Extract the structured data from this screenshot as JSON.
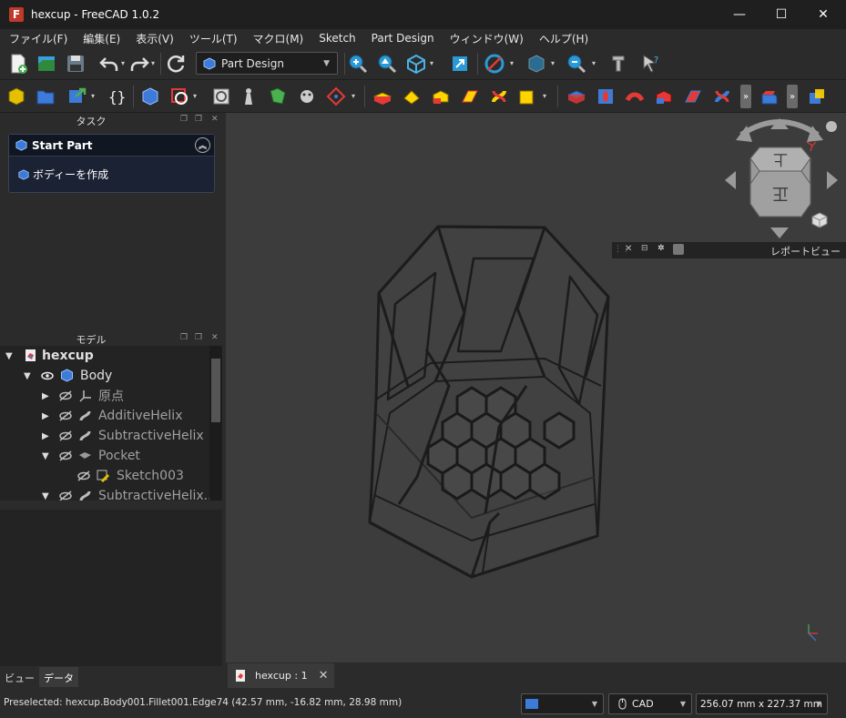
{
  "window": {
    "title": "hexcup - FreeCAD 1.0.2",
    "minimize": "—",
    "maximize": "☐",
    "close": "✕"
  },
  "menu": {
    "items": [
      "ファイル(F)",
      "編集(E)",
      "表示(V)",
      "ツール(T)",
      "マクロ(M)",
      "Sketch",
      "Part Design",
      "ウィンドウ(W)",
      "ヘルプ(H)"
    ]
  },
  "toolbar": {
    "workbench": "Part Design",
    "more": "»"
  },
  "task_panel": {
    "title": "タスク",
    "header": "Start Part",
    "action": "ボディーを作成"
  },
  "model_panel": {
    "title": "モデル",
    "tree": [
      {
        "label": "hexcup"
      },
      {
        "label": "Body"
      },
      {
        "label": "原点"
      },
      {
        "label": "AdditiveHelix"
      },
      {
        "label": "SubtractiveHelix"
      },
      {
        "label": "Pocket"
      },
      {
        "label": "Sketch003"
      },
      {
        "label": "SubtractiveHelix..."
      }
    ]
  },
  "left_tabs": [
    "ビュー",
    "データ"
  ],
  "report_view": {
    "title": "レポートビュー"
  },
  "document_tab": {
    "label": "hexcup : 1",
    "close": "✕"
  },
  "navcube": {
    "top_face": "上",
    "front_face": "正"
  },
  "status": {
    "preselected": "Preselected: hexcup.Body001.Fillet001.Edge74 (42.57 mm, -16.82 mm, 28.98 mm)",
    "nav_style": "CAD",
    "dimensions": "256.07 mm x 227.37 mm"
  },
  "colors": {
    "background": "#2b2b2b",
    "view_bg": "#3c3c3c",
    "accent_blue": "#3d7bd9",
    "task_bg": "#1b2233"
  }
}
